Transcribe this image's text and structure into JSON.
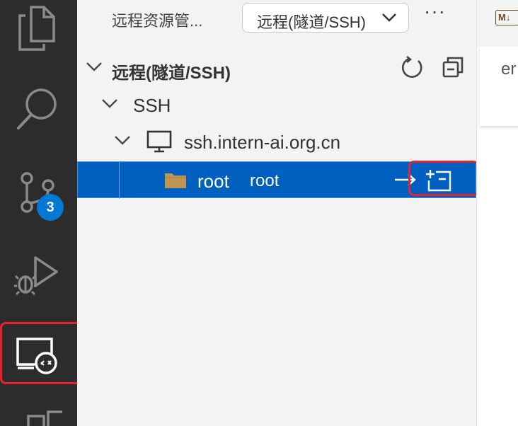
{
  "activity_bar": {
    "source_control_badge": "3"
  },
  "sidebar": {
    "view_title": "远程资源管...",
    "view_select_value": "远程(隧道/SSH)",
    "more_label": "···",
    "tree": {
      "section_label": "远程(隧道/SSH)",
      "group_label": "SSH",
      "host_label": "ssh.intern-ai.org.cn",
      "folder_name": "root",
      "folder_description": "root"
    }
  },
  "editor": {
    "tab_icon_label": "M↓",
    "text_fragment": "er"
  },
  "colors": {
    "selection": "#0060c0",
    "highlight_border": "#e5232d",
    "badge": "#0078d4"
  }
}
